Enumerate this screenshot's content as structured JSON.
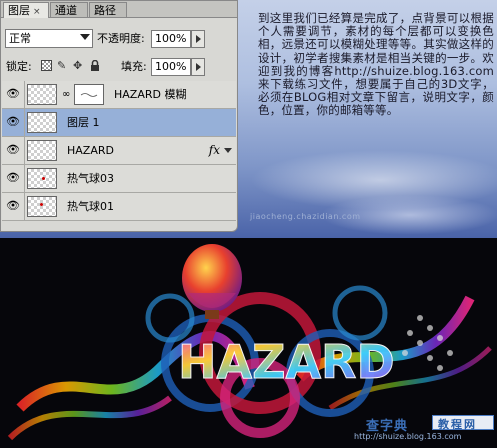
{
  "panel": {
    "tabs": [
      {
        "label": "图层",
        "close": "×",
        "active": true
      },
      {
        "label": "通道",
        "active": false
      },
      {
        "label": "路径",
        "active": false
      }
    ],
    "blend_mode": "正常",
    "opacity_label": "不透明度:",
    "opacity_value": "100%",
    "lock_label": "锁定:",
    "fill_label": "填充:",
    "fill_value": "100%",
    "layers": [
      {
        "name": "HAZARD 模糊",
        "visible": true,
        "selected": false,
        "has_mask": true,
        "fx": ""
      },
      {
        "name": "图层 1",
        "visible": true,
        "selected": true,
        "has_mask": false,
        "fx": ""
      },
      {
        "name": "HAZARD",
        "visible": true,
        "selected": false,
        "has_mask": false,
        "fx": "fx"
      },
      {
        "name": "热气球03",
        "visible": true,
        "selected": false,
        "has_mask": false,
        "fx": ""
      },
      {
        "name": "热气球01",
        "visible": true,
        "selected": false,
        "has_mask": false,
        "fx": ""
      }
    ]
  },
  "article": {
    "text": "到这里我们已经算是完成了，点背景可以根据个人需要调节，素材的每个层都可以变换色相，远景还可以模糊处理等等。其实做这样的设计，初学者搜集素材是相当关键的一步。欢迎到我的博客http://shuize.blog.163.com来下载练习文件，想要属于自己的3D文字，必须在BLOG相对文章下留言，说明文字，颜色，位置，你的邮箱等等。"
  },
  "artwork": {
    "title_text": "HAZARD",
    "colors": {
      "background": "#06060b",
      "balloon": "#e8402e",
      "ring_red": "#c2183a",
      "ring_blue": "#1e5fb8"
    }
  },
  "watermarks": {
    "mid": "jiaocheng.chazidian.com",
    "main": "查字典",
    "box": "教程网",
    "sub": "http://shuize.blog.163.com"
  }
}
